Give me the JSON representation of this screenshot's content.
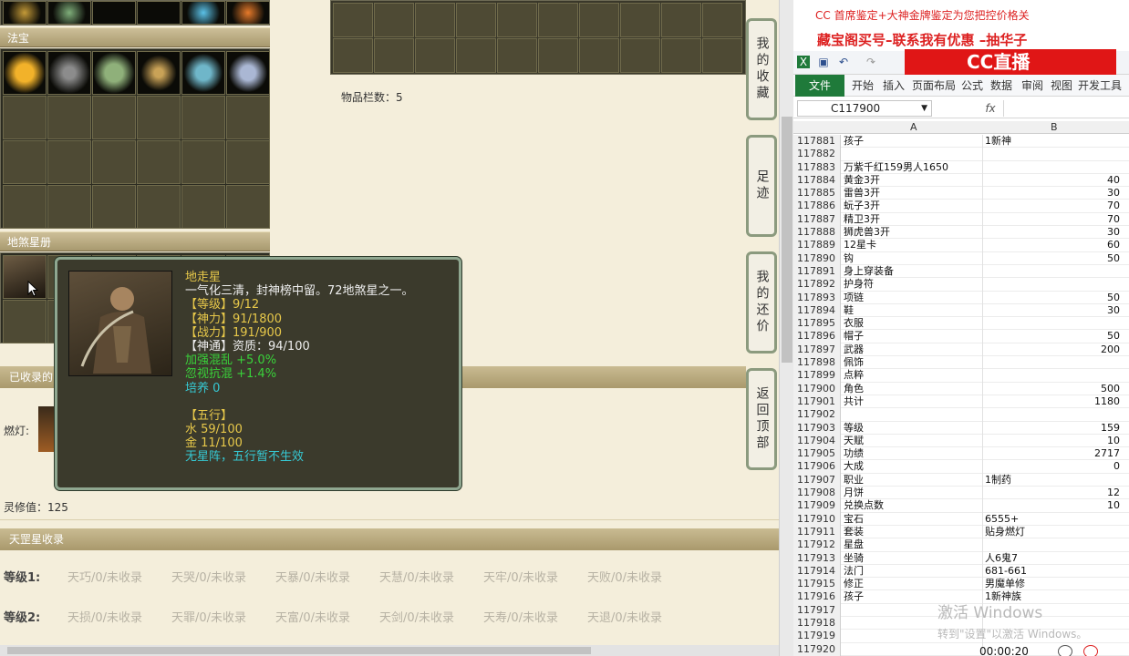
{
  "game": {
    "fabao_title": "法宝",
    "disha_title": "地煞星册",
    "collected_title": "已收录的",
    "ranlamp_label": "燃灯:",
    "lingxiu": "灵修值：125",
    "item_count": "物品栏数：5",
    "tiangang_title": "天罡星收录",
    "side_buttons": [
      {
        "label": "我的收藏"
      },
      {
        "label": "足迹"
      },
      {
        "label": "我的还价"
      },
      {
        "label": "返回顶部"
      }
    ],
    "tier1": {
      "label": "等级1:",
      "items": [
        "天巧/0/未收录",
        "天哭/0/未收录",
        "天暴/0/未收录",
        "天慧/0/未收录",
        "天牢/0/未收录",
        "天败/0/未收录"
      ]
    },
    "tier2": {
      "label": "等级2:",
      "items": [
        "天损/0/未收录",
        "天罪/0/未收录",
        "天富/0/未收录",
        "天剑/0/未收录",
        "天寿/0/未收录",
        "天退/0/未收录"
      ]
    },
    "tooltip": {
      "name": "地走星",
      "desc": "一气化三清，封神榜中留。72地煞星之一。",
      "level": "【等级】9/12",
      "shenli": "【神力】91/1800",
      "zhanli": "【战力】191/900",
      "shentong": "【神通】资质：94/100",
      "bonus1": "加强混乱 +5.0%",
      "bonus2": "忽视抗混 +1.4%",
      "peiyang": "培养 0",
      "wuxing_title": "【五行】",
      "water": "水 59/100",
      "gold": "金 11/100",
      "no_star": "无星阵，五行暂不生效"
    }
  },
  "excel": {
    "overlay_line1": "CC 首席鉴定+大神金牌鉴定为您把控价格关",
    "overlay_line2": "藏宝阁买号–联系我有优惠 –抽华子",
    "brand": "CC直播",
    "file_tab": "文件",
    "tabs": [
      "开始",
      "插入",
      "页面布局",
      "公式",
      "数据",
      "审阅",
      "视图",
      "开发工具"
    ],
    "name_box": "C117900",
    "fx": "fx",
    "col_a": "A",
    "col_b": "B",
    "rows": [
      {
        "n": "117881",
        "a": "孩子",
        "b": "1新神"
      },
      {
        "n": "117882",
        "a": "",
        "b": ""
      },
      {
        "n": "117883",
        "a": "万紫千红159男人1650",
        "b": ""
      },
      {
        "n": "117884",
        "a": "黄金3开",
        "b": "40"
      },
      {
        "n": "117885",
        "a": "雷兽3开",
        "b": "30"
      },
      {
        "n": "117886",
        "a": "蚖子3开",
        "b": "70"
      },
      {
        "n": "117887",
        "a": "精卫3开",
        "b": "70"
      },
      {
        "n": "117888",
        "a": "狮虎兽3开",
        "b": "30"
      },
      {
        "n": "117889",
        "a": "12星卡",
        "b": "60"
      },
      {
        "n": "117890",
        "a": "钩",
        "b": "50"
      },
      {
        "n": "117891",
        "a": "身上穿装备",
        "b": ""
      },
      {
        "n": "117892",
        "a": "护身符",
        "b": ""
      },
      {
        "n": "117893",
        "a": "项链",
        "b": "50"
      },
      {
        "n": "117894",
        "a": "鞋",
        "b": "30"
      },
      {
        "n": "117895",
        "a": "衣服",
        "b": ""
      },
      {
        "n": "117896",
        "a": "帽子",
        "b": "50"
      },
      {
        "n": "117897",
        "a": "武器",
        "b": "200"
      },
      {
        "n": "117898",
        "a": "佩饰",
        "b": ""
      },
      {
        "n": "117899",
        "a": "点粹",
        "b": ""
      },
      {
        "n": "117900",
        "a": "角色",
        "b": "500"
      },
      {
        "n": "117901",
        "a": "共计",
        "b": "1180"
      },
      {
        "n": "117902",
        "a": "",
        "b": ""
      },
      {
        "n": "117903",
        "a": "等级",
        "b": "159"
      },
      {
        "n": "117904",
        "a": "天赋",
        "b": "10"
      },
      {
        "n": "117905",
        "a": "功绩",
        "b": "2717"
      },
      {
        "n": "117906",
        "a": "大成",
        "b": "0"
      },
      {
        "n": "117907",
        "a": "职业",
        "b": "1制药"
      },
      {
        "n": "117908",
        "a": "月饼",
        "b": "12"
      },
      {
        "n": "117909",
        "a": "兑换点数",
        "b": "10"
      },
      {
        "n": "117910",
        "a": "宝石",
        "b": "6555+"
      },
      {
        "n": "117911",
        "a": "套装",
        "b": "贴身燃灯"
      },
      {
        "n": "117912",
        "a": "星盘",
        "b": ""
      },
      {
        "n": "117913",
        "a": "坐骑",
        "b": "人6鬼7"
      },
      {
        "n": "117914",
        "a": "法门",
        "b": "681-661"
      },
      {
        "n": "117915",
        "a": "修正",
        "b": "男魔单修"
      },
      {
        "n": "117916",
        "a": "孩子",
        "b": "1新神族"
      },
      {
        "n": "117917",
        "a": "",
        "b": ""
      },
      {
        "n": "117918",
        "a": "",
        "b": ""
      },
      {
        "n": "117919",
        "a": "",
        "b": ""
      },
      {
        "n": "117920",
        "a": "",
        "b": ""
      }
    ],
    "activation1": "激活 Windows",
    "activation2": "转到\"设置\"以激活 Windows。",
    "timer": "00:00:20"
  }
}
